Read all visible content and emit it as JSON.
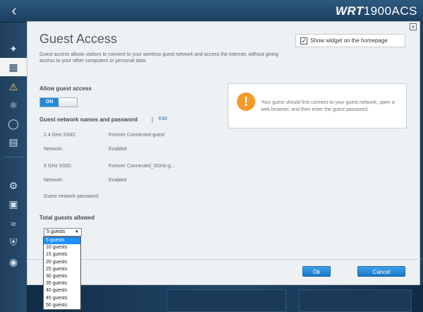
{
  "brand": {
    "bold": "WRT",
    "rest": "1900ACS"
  },
  "dialog": {
    "title": "Guest Access",
    "show_widget_label": "Show widget on the homepage",
    "show_widget_checked": true,
    "description": "Guest access allows visitors to connect to your wireless guest network and access the Internet, without giving access to your other computers or personal data.",
    "allow_label": "Allow guest access",
    "toggle_label": "ON",
    "names_header": "Guest network names and password",
    "pipe": "|",
    "edit_label": "Edit",
    "fields": [
      {
        "label": "2.4 GHz SSID:",
        "value": "Forever Connected-guest"
      },
      {
        "label": "Network:",
        "value": "Enabled"
      },
      {
        "label": "5 GHz SSID:",
        "value": "Forever Connected_5GHz-g..."
      },
      {
        "label": "Network:",
        "value": "Enabled"
      },
      {
        "label": "Guest network password:",
        "value": ""
      }
    ],
    "info_text": "Your guest should first connect to your guest network, open a web browser, and then enter the guest password.",
    "total_label": "Total guests allowed",
    "selected_guests": "5 guests",
    "guest_options": [
      "5 guests",
      "10 guests",
      "15 guests",
      "20 guests",
      "25 guests",
      "30 guests",
      "35 guests",
      "40 guests",
      "45 guests",
      "50 guests"
    ],
    "ok_label": "Ok",
    "cancel_label": "Cancel"
  },
  "colors": {
    "accent": "#1f8ad6",
    "warning": "#f39a2a",
    "nav": "#1e3f5c"
  }
}
